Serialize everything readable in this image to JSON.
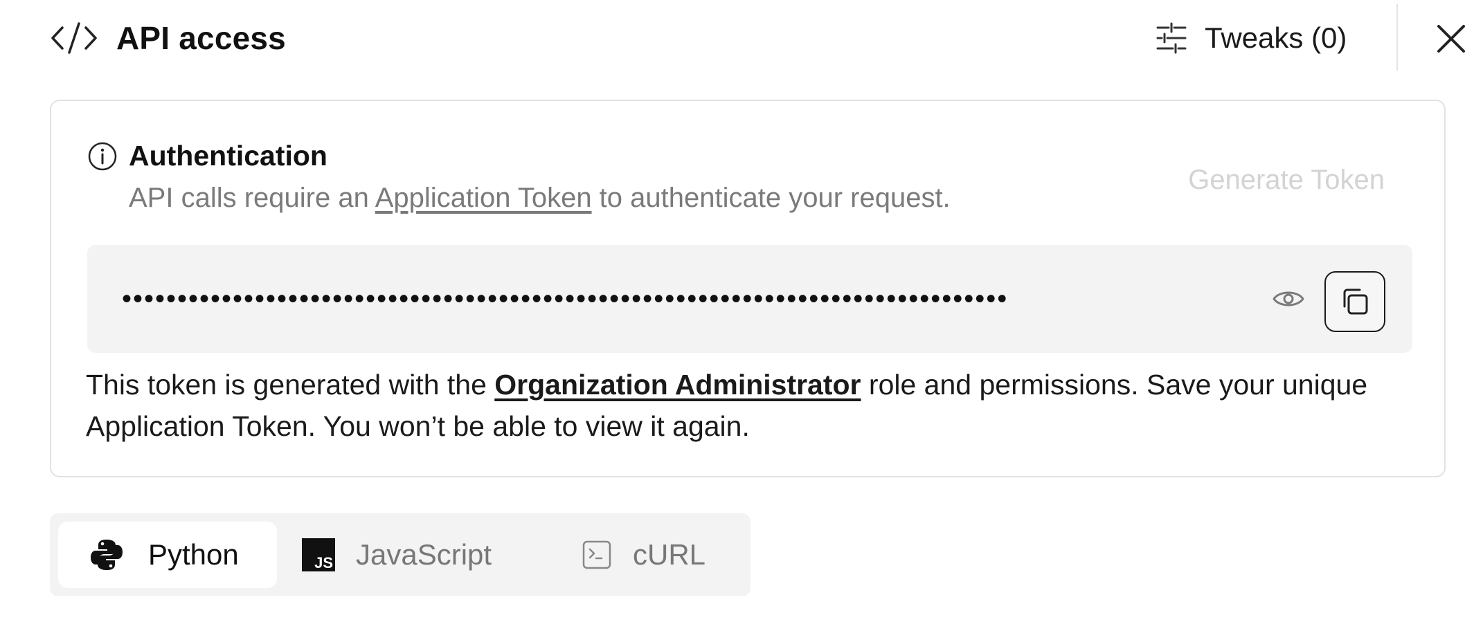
{
  "header": {
    "title": "API access",
    "tweaks_label": "Tweaks (0)"
  },
  "auth": {
    "title": "Authentication",
    "subtitle_before": "API calls require an ",
    "subtitle_link": "Application Token",
    "subtitle_after": " to authenticate your request.",
    "generate_token_label": "Generate Token",
    "token_masked": "••••••••••••••••••••••••••••••••••••••••••••••••••••••••••••••••••••••••••••••••",
    "note_before": "This token is generated with the ",
    "note_role": "Organization Administrator",
    "note_after": " role and permissions. Save your unique Application Token. You won’t be able to view it again."
  },
  "tabs": [
    {
      "label": "Python",
      "active": true,
      "icon": "python-icon"
    },
    {
      "label": "JavaScript",
      "active": false,
      "icon": "javascript-icon"
    },
    {
      "label": "cURL",
      "active": false,
      "icon": "terminal-icon"
    }
  ],
  "icons": {
    "js_badge": "JS"
  }
}
